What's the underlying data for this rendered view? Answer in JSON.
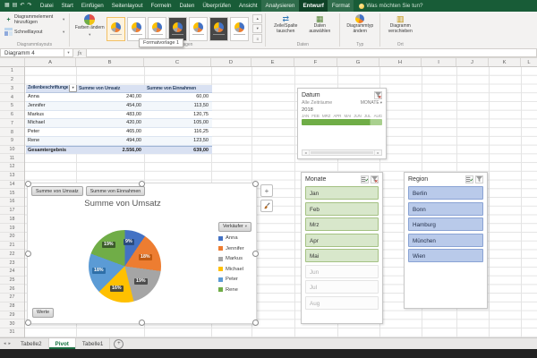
{
  "app": {
    "tabs": [
      "Datei",
      "Start",
      "Einfügen",
      "Seitenlayout",
      "Formeln",
      "Daten",
      "Überprüfen",
      "Ansicht",
      "Analysieren",
      "Entwurf",
      "Format"
    ],
    "active_tab": "Entwurf",
    "tell_me": "Was möchten Sie tun?"
  },
  "ribbon": {
    "layouts_group": {
      "add_chart_element": "Diagrammelement hinzufügen",
      "quick_layout": "Schnelllayout",
      "label": "Diagrammlayouts"
    },
    "styles_group": {
      "change_colors": "Farben ändern",
      "label": "Diagrammformatvorlagen"
    },
    "data_group": {
      "swap": "Zeile/Spalte tauschen",
      "select": "Daten auswählen",
      "label": "Daten"
    },
    "type_group": {
      "change_type": "Diagrammtyp ändern",
      "label": "Typ"
    },
    "location_group": {
      "move_chart": "Diagramm verschieben",
      "label": "Ort"
    },
    "tooltip": "Formatvorlage 1"
  },
  "formula_bar": {
    "name_box": "Diagramm 4",
    "fx_label": "fx"
  },
  "sheet": {
    "columns": [
      "A",
      "B",
      "C",
      "D",
      "E",
      "F",
      "G",
      "H",
      "I",
      "J",
      "K",
      "L"
    ],
    "rows": [
      "1",
      "2",
      "3",
      "4",
      "5",
      "6",
      "7",
      "8",
      "9",
      "10",
      "11",
      "12",
      "13",
      "14",
      "15",
      "16",
      "17",
      "18",
      "19",
      "20",
      "21",
      "22",
      "23",
      "24",
      "25",
      "26",
      "27",
      "28",
      "29",
      "30",
      "31"
    ]
  },
  "pivot_table": {
    "header": [
      "Zeilenbeschriftungen",
      "Summe von Umsatz",
      "Summe von Einnahmen"
    ],
    "rows": [
      [
        "Anna",
        "240,00",
        "60,00"
      ],
      [
        "Jennifer",
        "454,00",
        "113,50"
      ],
      [
        "Markus",
        "483,00",
        "120,75"
      ],
      [
        "Michael",
        "420,00",
        "105,00"
      ],
      [
        "Peter",
        "465,00",
        "116,25"
      ],
      [
        "Rene",
        "494,00",
        "123,50"
      ]
    ],
    "total": [
      "Gesamtergebnis",
      "2.556,00",
      "639,00"
    ]
  },
  "chart": {
    "type": "pie",
    "field_buttons": [
      "Summe von Umsatz",
      "Summe von Einnahmen"
    ],
    "title": "Summe von Umsatz",
    "legend_field": "Verkäufer",
    "axis_field": "Werte",
    "series": [
      {
        "name": "Anna",
        "value": 240,
        "pct": "9%",
        "color": "#4472C4"
      },
      {
        "name": "Jennifer",
        "value": 454,
        "pct": "18%",
        "color": "#ED7D31"
      },
      {
        "name": "Markus",
        "value": 483,
        "pct": "19%",
        "color": "#A5A5A5"
      },
      {
        "name": "Michael",
        "value": 420,
        "pct": "16%",
        "color": "#FFC000"
      },
      {
        "name": "Peter",
        "value": 465,
        "pct": "18%",
        "color": "#5B9BD5"
      },
      {
        "name": "Rene",
        "value": 494,
        "pct": "19%",
        "color": "#70AD47"
      }
    ]
  },
  "timeline": {
    "title": "Datum",
    "range_label": "Alle Zeiträume",
    "level_label": "MONATE",
    "year": "2018",
    "months": [
      "JAN",
      "FEB",
      "MRZ",
      "APR",
      "MAI",
      "JUN",
      "JUL",
      "AUG"
    ],
    "bar_color": "#70AD47"
  },
  "slicers": {
    "monate": {
      "title": "Monate",
      "items": [
        {
          "label": "Jan",
          "state": "selected"
        },
        {
          "label": "Feb",
          "state": "selected"
        },
        {
          "label": "Mrz",
          "state": "selected"
        },
        {
          "label": "Apr",
          "state": "selected"
        },
        {
          "label": "Mai",
          "state": "selected"
        },
        {
          "label": "Jun",
          "state": "empty"
        },
        {
          "label": "Jul",
          "state": "empty"
        },
        {
          "label": "Aug",
          "state": "empty"
        }
      ]
    },
    "region": {
      "title": "Region",
      "items": [
        {
          "label": "Berlin",
          "state": "selected"
        },
        {
          "label": "Bonn",
          "state": "selected"
        },
        {
          "label": "Hamburg",
          "state": "selected"
        },
        {
          "label": "München",
          "state": "selected"
        },
        {
          "label": "Wien",
          "state": "selected"
        }
      ]
    }
  },
  "sheet_tabs": {
    "tabs": [
      "Tabelle2",
      "Pivot",
      "Tabelle1"
    ],
    "active": "Pivot"
  },
  "colors": {
    "titlebar_green": "#185C37",
    "accent_green": "#217346",
    "pivot_header_fill": "#D9E1F2",
    "slicer_selected_green": "#D8E7CB",
    "slicer_selected_blue": "#B9CAEA"
  }
}
